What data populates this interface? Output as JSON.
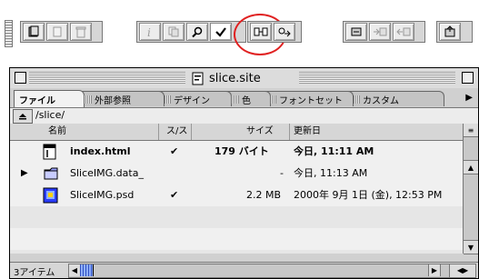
{
  "toolbar": {
    "groups": [
      {
        "buttons": [
          "site-icon",
          "file-icon",
          "trash-icon"
        ]
      },
      {
        "buttons": [
          "info-icon",
          "copy-icon",
          "search-icon",
          "checkmark-icon"
        ]
      },
      {
        "buttons": [
          "link-icon",
          "arrow-link-icon"
        ]
      },
      {
        "buttons": [
          "plugin-icon",
          "plugin-in-icon",
          "plugin-out-icon"
        ]
      },
      {
        "buttons": [
          "upload-icon"
        ]
      }
    ],
    "highlight_color": "#e02020"
  },
  "window": {
    "title": "slice.site",
    "tabs": [
      "ファイル",
      "外部参照",
      "デザイン",
      "色",
      "フォントセット",
      "カスタム"
    ],
    "path": "/slice/",
    "columns": {
      "name": "名前",
      "status": "ス/ス",
      "size": "サイズ",
      "modified": "更新日"
    },
    "rows": [
      {
        "name": "index.html",
        "status": "✔",
        "size": "179 バイト",
        "modified": "今日, 11:11 AM",
        "bold": true,
        "icon": "html-file-icon"
      },
      {
        "name": "SliceIMG.data_",
        "status": "",
        "size": "-",
        "modified": "今日, 11:13 AM",
        "bold": false,
        "icon": "folder-icon"
      },
      {
        "name": "SliceIMG.psd",
        "status": "✔",
        "size": "2.2 MB",
        "modified": "2000年 9月 1日 (金), 12:53 PM",
        "bold": false,
        "icon": "psd-file-icon"
      }
    ],
    "status": "3アイテム"
  }
}
